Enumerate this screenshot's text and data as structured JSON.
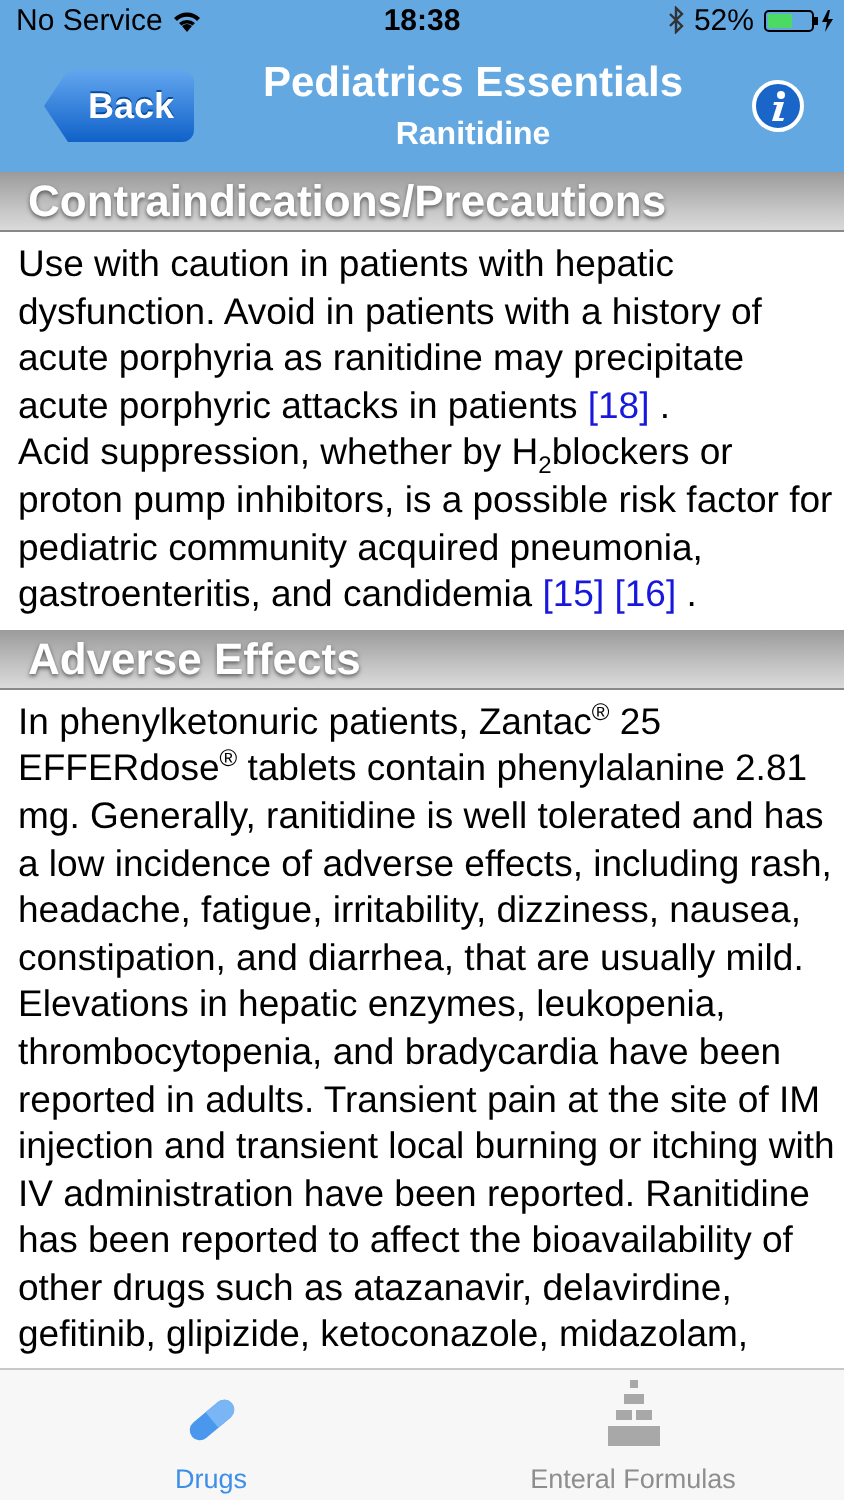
{
  "status_bar": {
    "carrier": "No Service",
    "time": "18:38",
    "battery": "52%"
  },
  "nav_bar": {
    "back": "Back",
    "title": "Pediatrics Essentials",
    "subtitle": "Ranitidine"
  },
  "sections": [
    {
      "title": "Contraindications/Precautions",
      "paragraphs": [
        [
          {
            "kind": "text",
            "text": "Use with caution in patients with hepatic dysfunction. Avoid in patients with a history of acute porphyria as ranitidine may precipitate acute porphyric attacks in patients "
          },
          {
            "kind": "link",
            "text": "[18]"
          },
          {
            "kind": "text",
            "text": " ."
          }
        ],
        [
          {
            "kind": "text",
            "text": "Acid suppression, whether by H$_{2}$blockers or proton pump inhibitors, is a possible risk factor for pediatric community acquired pneumonia, gastroenteritis, and candidemia "
          },
          {
            "kind": "link",
            "text": "[15]"
          },
          {
            "kind": "link",
            "text": "[16]"
          },
          {
            "kind": "text",
            "text": " ."
          }
        ]
      ]
    },
    {
      "title": "Adverse Effects",
      "paragraphs": [
        [
          {
            "kind": "text",
            "text": "In phenylketonuric patients, Zantac$^{®}$ 25 EFFERdose$^{®}$ tablets contain phenylalanine 2.81 mg. Generally, ranitidine is well tolerated and has a low incidence of adverse effects, including rash, headache, fatigue, irritability, dizziness, nausea, constipation, and diarrhea, that are usually mild. Elevations in hepatic enzymes, leukopenia, thrombocytopenia, and bradycardia have been reported in adults. Transient pain at the site of IM injection and transient local burning or itching with IV administration have been reported. Ranitidine has been reported to affect the bioavailability of other drugs such as atazanavir, delavirdine, gefitinib, glipizide, ketoconazole, midazolam,"
          }
        ]
      ]
    }
  ],
  "tab_bar": [
    {
      "label": "Drugs",
      "kind": "pill",
      "selected": true
    },
    {
      "label": "Enteral Formulas",
      "kind": "pyramid",
      "selected": false
    }
  ]
}
